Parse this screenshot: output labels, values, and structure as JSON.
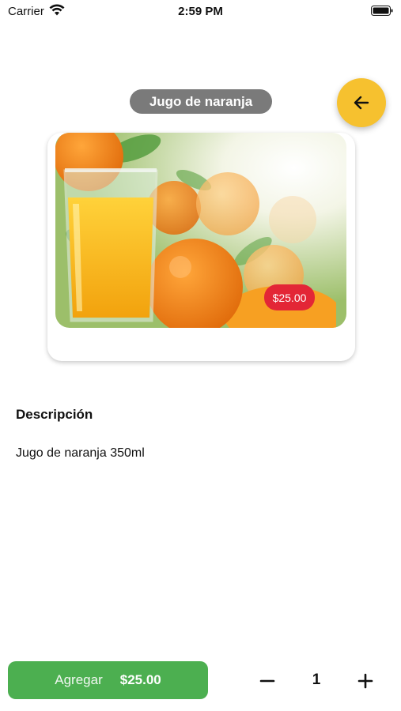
{
  "status_bar": {
    "carrier": "Carrier",
    "time": "2:59 PM",
    "icons": [
      "wifi-icon",
      "battery-icon"
    ]
  },
  "header": {
    "title": "Jugo de naranja",
    "back_icon": "arrow-left-icon",
    "back_color": "#f6c12f"
  },
  "product": {
    "image": "orange-juice-photo",
    "price": "$25.00",
    "price_badge_color": "#e32636"
  },
  "description": {
    "heading": "Descripción",
    "text": "Jugo de naranja 350ml"
  },
  "cart": {
    "add_label": "Agregar",
    "add_price": "$25.00",
    "add_color": "#4caf50",
    "quantity": "1",
    "minus_icon": "minus-icon",
    "plus_icon": "plus-icon"
  }
}
